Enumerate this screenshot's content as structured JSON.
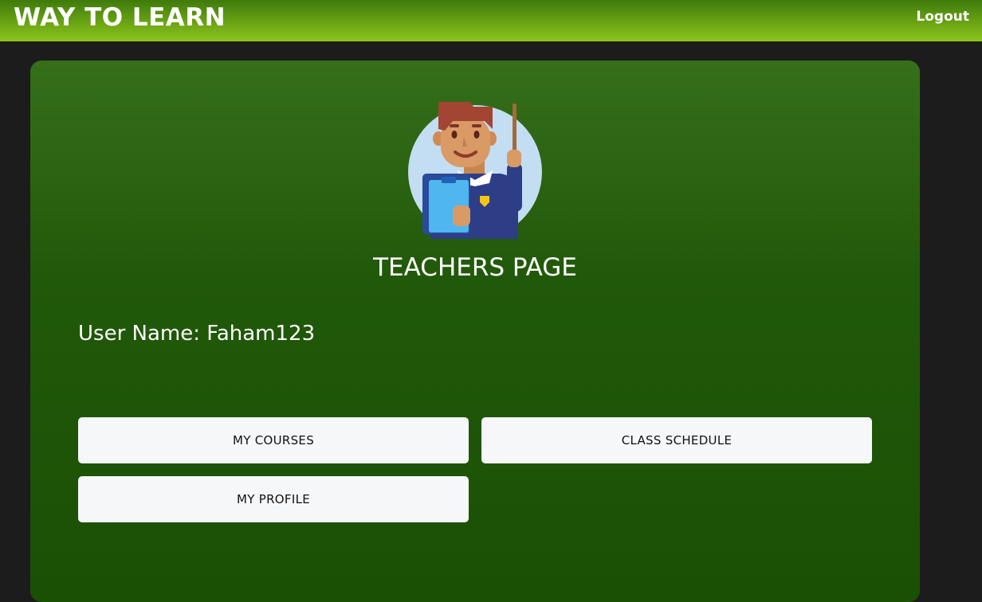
{
  "header": {
    "brand": "WAY TO LEARN",
    "logout_label": "Logout"
  },
  "main": {
    "avatar_icon": "teacher-avatar-icon",
    "title": "TEACHERS PAGE",
    "username_label": "User Name:",
    "username_value": "Faham123",
    "buttons": [
      {
        "label": "MY COURSES"
      },
      {
        "label": "CLASS SCHEDULE"
      },
      {
        "label": "MY PROFILE"
      }
    ]
  },
  "colors": {
    "header_gradient_top": "#3f7a0c",
    "header_gradient_bottom": "#8dc41c",
    "card_green": "#21590a",
    "page_background": "#1c1c1c",
    "button_background": "#f6f7f9"
  }
}
